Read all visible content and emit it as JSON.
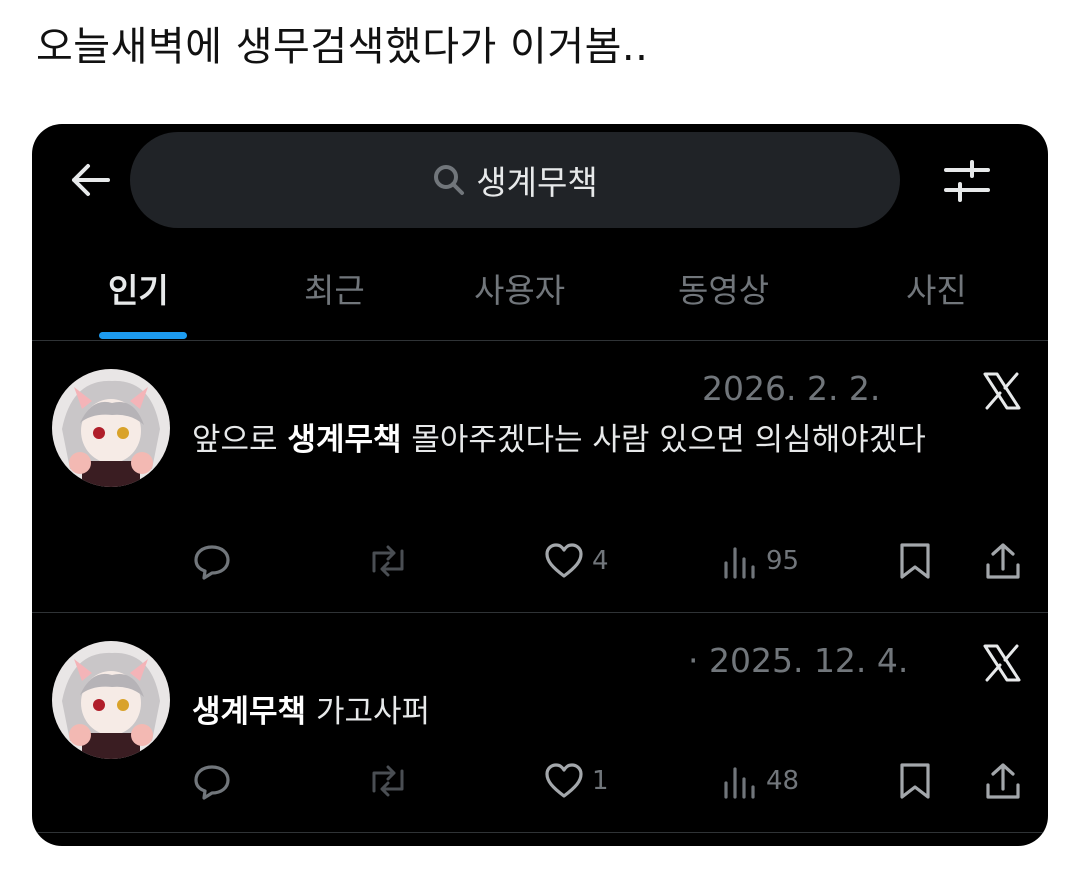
{
  "caption": "오늘새벽에 생무검색했다가 이거봄..",
  "search": {
    "query": "생계무책"
  },
  "tabs": [
    {
      "label": "인기"
    },
    {
      "label": "최근"
    },
    {
      "label": "사용자"
    },
    {
      "label": "동영상"
    },
    {
      "label": "사진"
    }
  ],
  "posts": [
    {
      "date": "2026. 2. 2.",
      "text_before": "앞으로 ",
      "text_highlight": "생계무책",
      "text_after": " 몰아주겠다는 사람 있으면 의심해야겠다",
      "likes": "4",
      "views": "95"
    },
    {
      "date": "· 2025. 12. 4.",
      "text_before": "",
      "text_highlight": "생계무책",
      "text_after": " 가고사퍼",
      "likes": "1",
      "views": "48"
    }
  ],
  "colors": {
    "accent": "#1d9bf0",
    "background": "#000000",
    "muted": "#71767b",
    "text": "#e7e9ea"
  }
}
